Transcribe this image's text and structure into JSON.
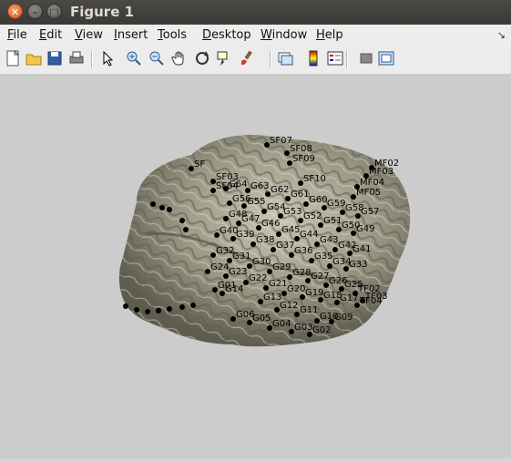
{
  "window": {
    "title": "Figure 1"
  },
  "menu": [
    {
      "label": "File",
      "u": "F",
      "rest": "ile"
    },
    {
      "label": "Edit",
      "u": "E",
      "rest": "dit"
    },
    {
      "label": "View",
      "u": "V",
      "rest": "iew"
    },
    {
      "label": "Insert",
      "u": "I",
      "rest": "nsert"
    },
    {
      "label": "Tools",
      "u": "T",
      "rest": "ools"
    },
    {
      "label": "Desktop",
      "u": "D",
      "rest": "esktop"
    },
    {
      "label": "Window",
      "u": "W",
      "rest": "indow"
    },
    {
      "label": "Help",
      "u": "H",
      "rest": "elp"
    }
  ],
  "toolbar": [
    "new-figure",
    "open-file",
    "save-figure",
    "print-figure",
    "edit-plot",
    "zoom-in",
    "zoom-out",
    "pan",
    "rotate-3d",
    "data-cursor",
    "brush",
    "link-plot",
    "insert-colorbar",
    "insert-legend",
    "hide-plot-tools",
    "show-plot-tools"
  ],
  "electrodes": [
    {
      "label": "SF07"
    },
    {
      "label": "SF08"
    },
    {
      "label": "SF09"
    },
    {
      "label": "SF10"
    },
    {
      "label": "MF02"
    },
    {
      "label": "MF03"
    },
    {
      "label": "MF04"
    },
    {
      "label": "MF05"
    },
    {
      "label": "G64"
    },
    {
      "label": "G63"
    },
    {
      "label": "G62"
    },
    {
      "label": "G61"
    },
    {
      "label": "G60"
    },
    {
      "label": "G59"
    },
    {
      "label": "G58"
    },
    {
      "label": "G57"
    },
    {
      "label": "G56"
    },
    {
      "label": "G55"
    },
    {
      "label": "G54"
    },
    {
      "label": "G53"
    },
    {
      "label": "G52"
    },
    {
      "label": "G51"
    },
    {
      "label": "G50"
    },
    {
      "label": "G49"
    },
    {
      "label": "G48"
    },
    {
      "label": "G47"
    },
    {
      "label": "G46"
    },
    {
      "label": "G45"
    },
    {
      "label": "G44"
    },
    {
      "label": "G43"
    },
    {
      "label": "G42"
    },
    {
      "label": "G41"
    },
    {
      "label": "G40"
    },
    {
      "label": "G39"
    },
    {
      "label": "G38"
    },
    {
      "label": "G37"
    },
    {
      "label": "G36"
    },
    {
      "label": "G35"
    },
    {
      "label": "G34"
    },
    {
      "label": "G33"
    },
    {
      "label": "G32"
    },
    {
      "label": "G31"
    },
    {
      "label": "G30"
    },
    {
      "label": "G29"
    },
    {
      "label": "G28"
    },
    {
      "label": "G27"
    },
    {
      "label": "G26"
    },
    {
      "label": "G25"
    },
    {
      "label": "G24"
    },
    {
      "label": "G23"
    },
    {
      "label": "G22"
    },
    {
      "label": "G21"
    },
    {
      "label": "G20"
    },
    {
      "label": "G19"
    },
    {
      "label": "G18"
    },
    {
      "label": "G17"
    },
    {
      "label": "G14"
    },
    {
      "label": "G13"
    },
    {
      "label": "G12"
    },
    {
      "label": "G11"
    },
    {
      "label": "G10"
    },
    {
      "label": "G09"
    },
    {
      "label": "G06"
    },
    {
      "label": "G05"
    },
    {
      "label": "G04"
    },
    {
      "label": "G03"
    },
    {
      "label": "G02"
    },
    {
      "label": "G01"
    },
    {
      "label": "TF02"
    },
    {
      "label": "TF03"
    },
    {
      "label": "TF04"
    },
    {
      "label": "SF"
    },
    {
      "label": "SF03"
    },
    {
      "label": "SF04"
    }
  ]
}
